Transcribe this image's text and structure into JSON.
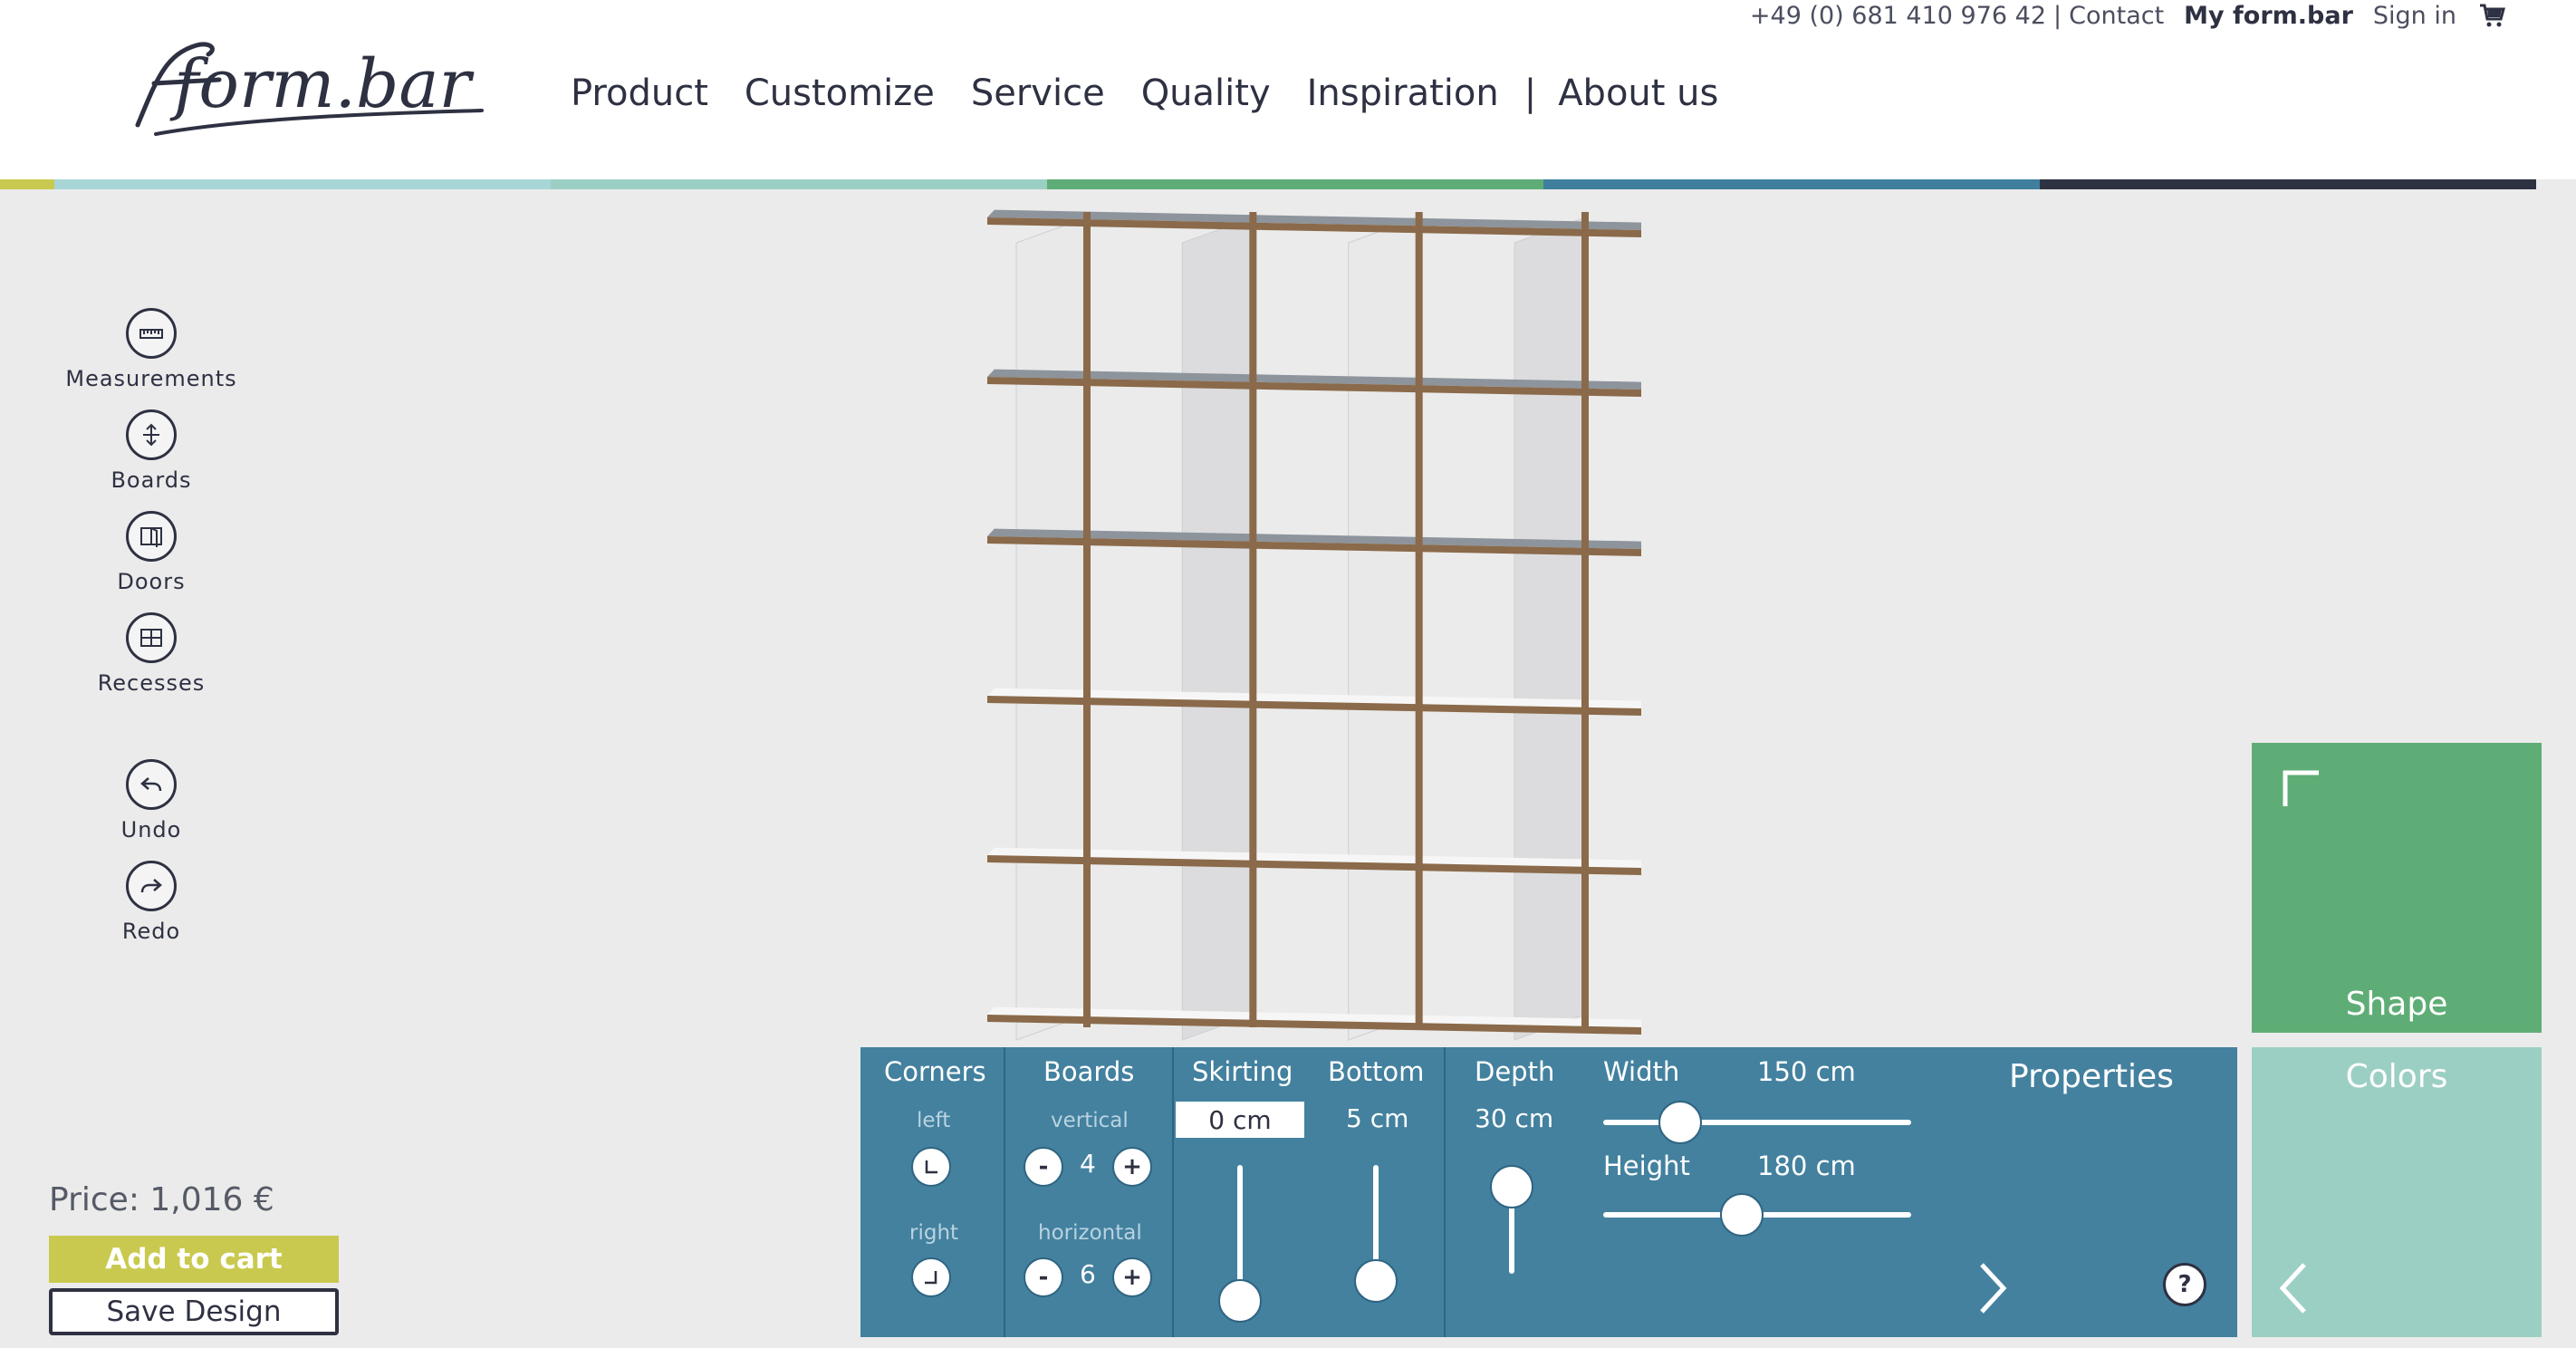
{
  "header": {
    "logo_text": "form.bar",
    "phone": "+49 (0) 681 410 976 42",
    "separator": "|",
    "contact": "Contact",
    "my_formbar": "My form.bar",
    "sign_in": "Sign in",
    "cart_icon": "cart-icon",
    "nav": [
      "Product",
      "Customize",
      "Service",
      "Quality",
      "Inspiration",
      "About us"
    ],
    "nav_pipe": "|",
    "color_stripe": [
      "#c9c94f",
      "#a8d6d6",
      "#9ccfc3",
      "#5fad76",
      "#3f7f9d",
      "#2e3142"
    ]
  },
  "tools": {
    "measurements": "Measurements",
    "boards": "Boards",
    "doors": "Doors",
    "recesses": "Recesses",
    "undo": "Undo",
    "redo": "Redo"
  },
  "price": {
    "label": "Price: 1,016 €"
  },
  "buttons": {
    "add_to_cart": "Add to cart",
    "save_design": "Save Design"
  },
  "properties": {
    "corners": {
      "title": "Corners",
      "left": "left",
      "right": "right"
    },
    "boards": {
      "title": "Boards",
      "vertical_label": "vertical",
      "vertical_value": "4",
      "horizontal_label": "horizontal",
      "horizontal_value": "6",
      "minus": "-",
      "plus": "+"
    },
    "skirting": {
      "title": "Skirting",
      "value": "0 cm",
      "level": 0
    },
    "bottom": {
      "title": "Bottom",
      "value": "5 cm",
      "level": 0.15
    },
    "depth": {
      "title": "Depth",
      "value": "30 cm",
      "level": 0.8
    },
    "width": {
      "title": "Width",
      "value": "150 cm",
      "level": 0.25
    },
    "height": {
      "title": "Height",
      "value": "180 cm",
      "level": 0.45
    },
    "panel_title": "Properties",
    "help": "?"
  },
  "tabs": {
    "shape": "Shape",
    "colors": "Colors"
  },
  "colors": {
    "panel": "#43819f",
    "shape_tab": "#5fad76",
    "colors_tab": "#9ccfc3",
    "add_to_cart": "#c9c94f",
    "wood_edge": "#8a6a4a"
  }
}
